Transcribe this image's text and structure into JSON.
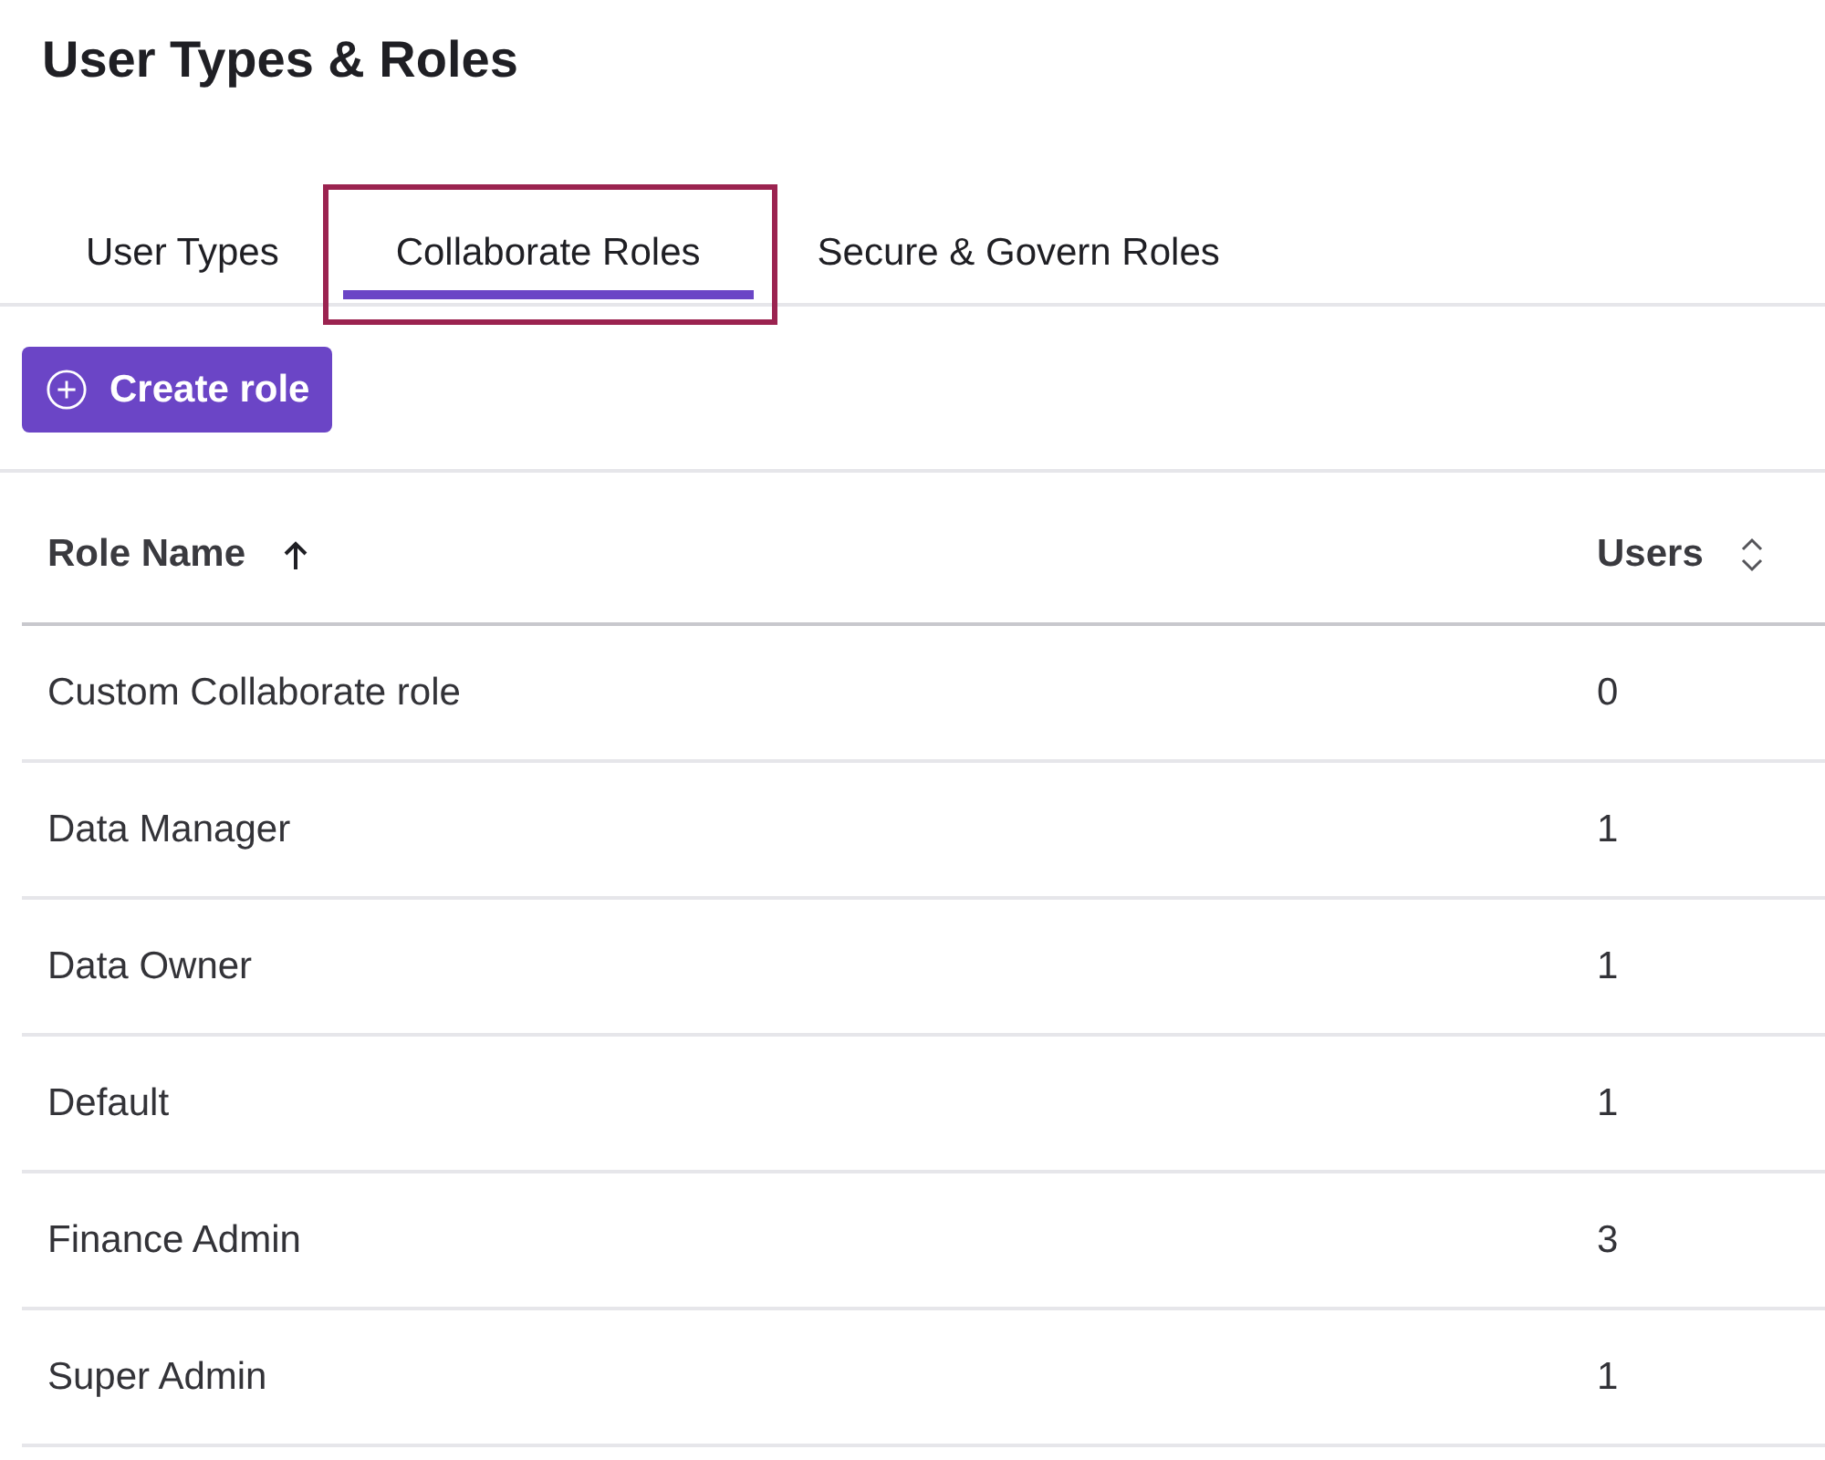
{
  "page": {
    "title": "User Types & Roles"
  },
  "tabs": [
    {
      "label": "User Types",
      "selected": false,
      "highlighted": false
    },
    {
      "label": "Collaborate Roles",
      "selected": true,
      "highlighted": true
    },
    {
      "label": "Secure & Govern Roles",
      "selected": false,
      "highlighted": false
    }
  ],
  "create_button": {
    "label": "Create role"
  },
  "table": {
    "columns": [
      {
        "label": "Role Name",
        "sorted": true
      },
      {
        "label": "Users",
        "sorted": false
      }
    ],
    "rows": [
      {
        "cells": [
          "Custom Collaborate role",
          "0"
        ]
      },
      {
        "cells": [
          "Data Manager",
          "1"
        ]
      },
      {
        "cells": [
          "Data Owner",
          "1"
        ]
      },
      {
        "cells": [
          "Default",
          "1"
        ]
      },
      {
        "cells": [
          "Finance Admin",
          "3"
        ]
      },
      {
        "cells": [
          "Super Admin",
          "1"
        ]
      }
    ]
  }
}
